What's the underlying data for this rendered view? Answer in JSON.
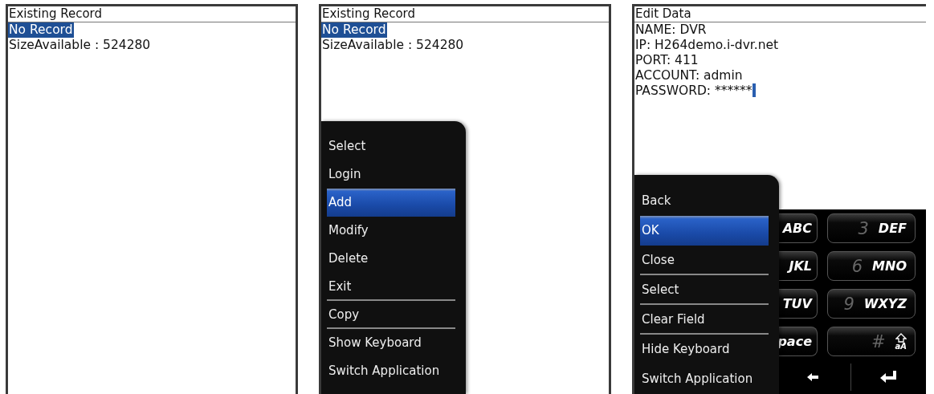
{
  "screens": [
    {
      "title": "Existing Record",
      "lines": [
        {
          "text": "No Record",
          "selected": true,
          "cursor": false
        },
        {
          "text": "SizeAvailable : 524280",
          "selected": false,
          "cursor": false
        }
      ]
    },
    {
      "title": "Existing Record",
      "lines": [
        {
          "text": "No Record",
          "selected": true,
          "cursor": false
        },
        {
          "text": "SizeAvailable : 524280",
          "selected": false,
          "cursor": false
        }
      ],
      "menu": {
        "items": [
          {
            "label": "Select",
            "selected": false,
            "divider_after": false
          },
          {
            "label": "Login",
            "selected": false,
            "divider_after": false
          },
          {
            "label": "Add",
            "selected": true,
            "divider_after": false
          },
          {
            "label": "Modify",
            "selected": false,
            "divider_after": false
          },
          {
            "label": "Delete",
            "selected": false,
            "divider_after": false
          },
          {
            "label": "Exit",
            "selected": false,
            "divider_after": true
          },
          {
            "label": "Copy",
            "selected": false,
            "divider_after": true
          },
          {
            "label": "Show Keyboard",
            "selected": false,
            "divider_after": false
          },
          {
            "label": "Switch Application",
            "selected": false,
            "divider_after": false
          }
        ]
      }
    },
    {
      "title": "Edit Data",
      "lines": [
        {
          "text": "NAME: DVR",
          "selected": false,
          "cursor": false
        },
        {
          "text": "IP: H264demo.i-dvr.net",
          "selected": false,
          "cursor": false
        },
        {
          "text": "PORT: 411",
          "selected": false,
          "cursor": false
        },
        {
          "text": "ACCOUNT: admin",
          "selected": false,
          "cursor": false
        },
        {
          "text": "PASSWORD: ******",
          "selected": false,
          "cursor": true
        }
      ],
      "keyboard": {
        "keys": [
          {
            "kind": "letters",
            "letters": "ABC"
          },
          {
            "kind": "digit",
            "number": "3",
            "letters": "DEF"
          },
          {
            "kind": "letters",
            "letters": "JKL"
          },
          {
            "kind": "digit",
            "number": "6",
            "letters": "MNO"
          },
          {
            "kind": "letters",
            "letters": "TUV"
          },
          {
            "kind": "digit",
            "number": "9",
            "letters": "WXYZ"
          },
          {
            "kind": "letters",
            "letters": "pace"
          },
          {
            "kind": "shift",
            "number": "#",
            "letters": "aA"
          }
        ]
      },
      "menu": {
        "items": [
          {
            "label": "Back",
            "selected": false,
            "divider_after": false
          },
          {
            "label": "OK",
            "selected": true,
            "divider_after": false
          },
          {
            "label": "Close",
            "selected": false,
            "divider_after": true
          },
          {
            "label": "Select",
            "selected": false,
            "divider_after": true
          },
          {
            "label": "Clear Field",
            "selected": false,
            "divider_after": true
          },
          {
            "label": "Hide Keyboard",
            "selected": false,
            "divider_after": false
          },
          {
            "label": "Switch Application",
            "selected": false,
            "divider_after": false
          }
        ]
      }
    }
  ]
}
